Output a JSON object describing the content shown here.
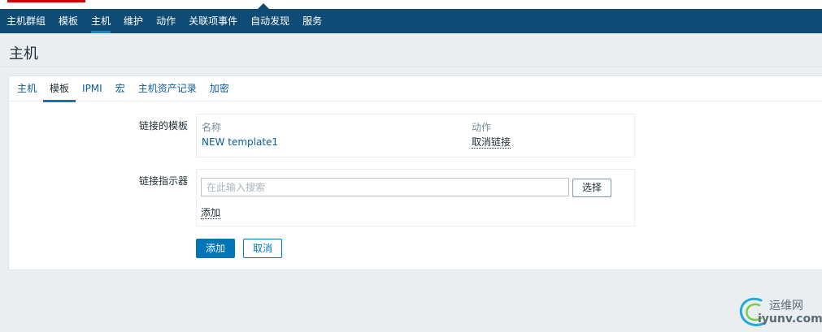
{
  "nav": {
    "items": [
      {
        "label": "主机群组",
        "active": false
      },
      {
        "label": "模板",
        "active": false
      },
      {
        "label": "主机",
        "active": true
      },
      {
        "label": "维护",
        "active": false
      },
      {
        "label": "动作",
        "active": false
      },
      {
        "label": "关联项事件",
        "active": false
      },
      {
        "label": "自动发现",
        "active": false
      },
      {
        "label": "服务",
        "active": false
      }
    ]
  },
  "page": {
    "title": "主机"
  },
  "tabs": [
    {
      "label": "主机",
      "active": false
    },
    {
      "label": "模板",
      "active": true
    },
    {
      "label": "IPMI",
      "active": false
    },
    {
      "label": "宏",
      "active": false
    },
    {
      "label": "主机资产记录",
      "active": false
    },
    {
      "label": "加密",
      "active": false
    }
  ],
  "linked_templates": {
    "label": "链接的模板",
    "col_name": "名称",
    "col_action": "动作",
    "rows": [
      {
        "name": "NEW template1",
        "action": "取消链接"
      }
    ]
  },
  "link_indicator": {
    "label": "链接指示器",
    "search_placeholder": "在此输入搜索",
    "search_value": "",
    "select_label": "选择",
    "add_link": "添加"
  },
  "form_buttons": {
    "add": "添加",
    "cancel": "取消"
  },
  "watermark": {
    "cn": "运维网",
    "en": "iyunv.com"
  },
  "colors": {
    "nav_bg": "#0f4c75",
    "primary": "#0275b8",
    "link": "#0b5b94",
    "page_bg": "#ebeef0"
  }
}
